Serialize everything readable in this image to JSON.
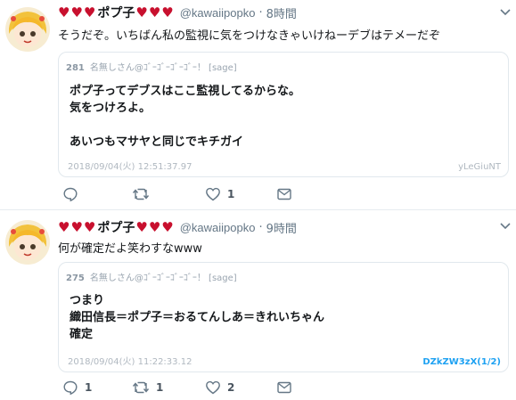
{
  "tweets": [
    {
      "display_name": "ポプ子",
      "handle": "@kawaiipopko",
      "separator": "·",
      "time": "8時間",
      "text": "そうだぞ。いちばん私の監視に気をつけなきゃいけねーデブはテメーだぞ",
      "post": {
        "number": "281",
        "header": "名無しさん@ｺﾞｰｺﾞｰｺﾞｰｺﾞｰ！ [sage]",
        "body": "ポプ子ってデブスはここ監視してるからな。\n気をつけろよ。\n\nあいつもマサヤと同じでキチガイ",
        "date": "2018/09/04(火) 12:51:37.97",
        "id": "yLeGiuNT"
      },
      "actions": {
        "reply": "",
        "retweet": "",
        "like": "1"
      }
    },
    {
      "display_name": "ポプ子",
      "handle": "@kawaiipopko",
      "separator": "·",
      "time": "9時間",
      "text": "何が確定だよ笑わすなwww",
      "post": {
        "number": "275",
        "header": "名無しさん@ｺﾞｰｺﾞｰｺﾞｰｺﾞｰ！ [sage]",
        "body": "つまり\n織田信長＝ポプ子＝おるてんしあ＝きれいちゃん\n確定",
        "date": "2018/09/04(火) 11:22:33.12",
        "id": "DZkZW3zX(1/2)"
      },
      "actions": {
        "reply": "1",
        "retweet": "1",
        "like": "2"
      }
    }
  ],
  "icons": {
    "heart_glyph": "♥",
    "heart_color": "#c8102e",
    "reply": "reply-icon",
    "retweet": "retweet-icon",
    "like": "like-icon",
    "dm": "message-icon",
    "menu": "chevron-down-icon"
  },
  "colors": {
    "link": "#1da1f2",
    "meta": "#657786",
    "border": "#e1e8ed"
  }
}
